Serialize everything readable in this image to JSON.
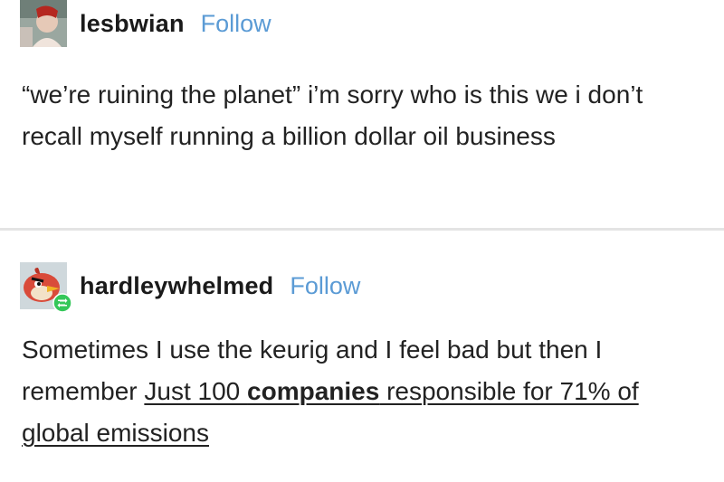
{
  "posts": [
    {
      "username": "lesbwian",
      "follow_label": "Follow",
      "text": "“we’re ruining the planet” i’m sorry who is this we i don’t recall myself running a billion dollar oil business"
    },
    {
      "username": "hardleywhelmed",
      "follow_label": "Follow",
      "text_before": "Sometimes I use the keurig and I feel bad but then I remember ",
      "link_part1": "Just 100 ",
      "link_bold": "companies",
      "link_part2": " responsible for 71% of global emissions",
      "reblog_badge_icon": "reblog-icon"
    }
  ],
  "colors": {
    "follow": "#5b9bd5",
    "reblog_badge": "#34c759",
    "divider": "#e4e4e4"
  }
}
